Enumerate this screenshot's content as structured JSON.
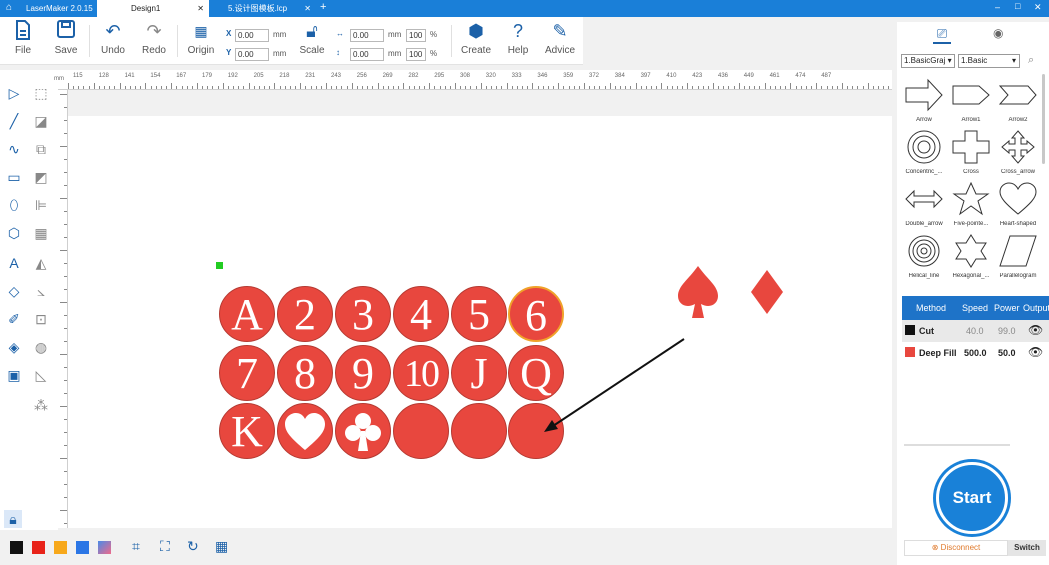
{
  "titlebar": {
    "home_icon": "home-icon",
    "tabs": [
      {
        "label": "LaserMaker 2.0.15"
      },
      {
        "label": "Design1"
      },
      {
        "label": "5.设计图模板.lcp"
      }
    ],
    "add_tab": "+",
    "win_min": "–",
    "win_max": "□",
    "win_close": "✕"
  },
  "toolbar": {
    "file": "File",
    "save": "Save",
    "undo": "Undo",
    "redo": "Redo",
    "origin": "Origin",
    "x_label": "X",
    "y_label": "Y",
    "x_value": "0.00",
    "y_value": "0.00",
    "w_value": "0.00",
    "h_value": "0.00",
    "unit": "mm",
    "w_pct": "100",
    "h_pct": "100",
    "pct": "%",
    "scale": "Scale",
    "create": "Create",
    "help": "Help",
    "advice": "Advice"
  },
  "ruler": {
    "unit": "mm",
    "top_ticks": [
      "115",
      "128",
      "141",
      "154",
      "167",
      "179",
      "192",
      "205",
      "218",
      "231",
      "243",
      "256",
      "269",
      "282",
      "295",
      "308",
      "320",
      "333",
      "346",
      "359",
      "372",
      "384",
      "397",
      "410",
      "423",
      "436",
      "449",
      "461",
      "474",
      "487"
    ]
  },
  "cards": {
    "row1": [
      "A",
      "2",
      "3",
      "4",
      "5",
      "6"
    ],
    "row2": [
      "7",
      "8",
      "9",
      "10",
      "J",
      "Q"
    ],
    "row3_letter": "K",
    "row3_suits": [
      "heart",
      "club"
    ]
  },
  "colors": {
    "accent": "#1a7fd8",
    "card_red": "#e8473e",
    "swatches": [
      "#111111",
      "#e8231a",
      "#f7a81b",
      "#2b76e5",
      "#e06b8a"
    ]
  },
  "right_panel": {
    "library_select": "1.BasicGraj",
    "category_select": "1.Basic",
    "shapes": [
      "Arrow",
      "Arrow1",
      "Arrow2",
      "Concentric_...",
      "Cross",
      "Cross_arrow",
      "Double_arrow",
      "Five-pointe...",
      "Heart-shaped",
      "Helical_line",
      "Hexagonal_...",
      "Parallelogram"
    ]
  },
  "layers": {
    "headers": [
      "Method",
      "Speed",
      "Power",
      "Output"
    ],
    "rows": [
      {
        "name": "Cut",
        "color": "#111111",
        "speed": "40.0",
        "power": "99.0"
      },
      {
        "name": "Deep Fill",
        "color": "#e8473e",
        "speed": "500.0",
        "power": "50.0"
      }
    ]
  },
  "device": {
    "start": "Start",
    "disconnect": "Disconnect",
    "switch": "Switch"
  }
}
